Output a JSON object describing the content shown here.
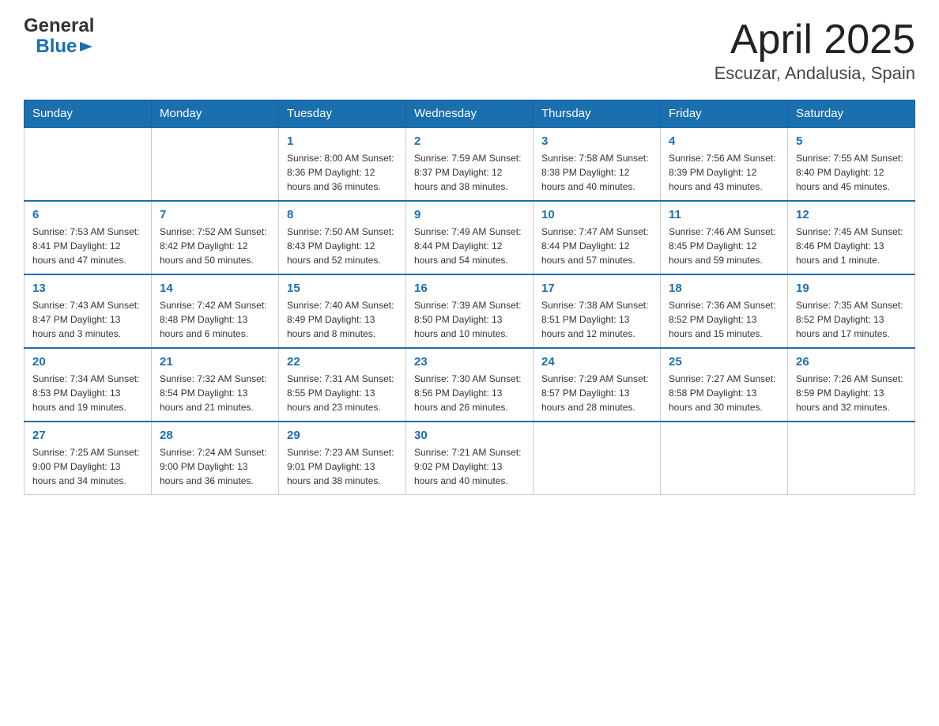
{
  "header": {
    "logo_text_general": "General",
    "logo_text_blue": "Blue",
    "title": "April 2025",
    "subtitle": "Escuzar, Andalusia, Spain"
  },
  "days_of_week": [
    "Sunday",
    "Monday",
    "Tuesday",
    "Wednesday",
    "Thursday",
    "Friday",
    "Saturday"
  ],
  "weeks": [
    [
      {
        "day": "",
        "info": ""
      },
      {
        "day": "",
        "info": ""
      },
      {
        "day": "1",
        "info": "Sunrise: 8:00 AM\nSunset: 8:36 PM\nDaylight: 12 hours\nand 36 minutes."
      },
      {
        "day": "2",
        "info": "Sunrise: 7:59 AM\nSunset: 8:37 PM\nDaylight: 12 hours\nand 38 minutes."
      },
      {
        "day": "3",
        "info": "Sunrise: 7:58 AM\nSunset: 8:38 PM\nDaylight: 12 hours\nand 40 minutes."
      },
      {
        "day": "4",
        "info": "Sunrise: 7:56 AM\nSunset: 8:39 PM\nDaylight: 12 hours\nand 43 minutes."
      },
      {
        "day": "5",
        "info": "Sunrise: 7:55 AM\nSunset: 8:40 PM\nDaylight: 12 hours\nand 45 minutes."
      }
    ],
    [
      {
        "day": "6",
        "info": "Sunrise: 7:53 AM\nSunset: 8:41 PM\nDaylight: 12 hours\nand 47 minutes."
      },
      {
        "day": "7",
        "info": "Sunrise: 7:52 AM\nSunset: 8:42 PM\nDaylight: 12 hours\nand 50 minutes."
      },
      {
        "day": "8",
        "info": "Sunrise: 7:50 AM\nSunset: 8:43 PM\nDaylight: 12 hours\nand 52 minutes."
      },
      {
        "day": "9",
        "info": "Sunrise: 7:49 AM\nSunset: 8:44 PM\nDaylight: 12 hours\nand 54 minutes."
      },
      {
        "day": "10",
        "info": "Sunrise: 7:47 AM\nSunset: 8:44 PM\nDaylight: 12 hours\nand 57 minutes."
      },
      {
        "day": "11",
        "info": "Sunrise: 7:46 AM\nSunset: 8:45 PM\nDaylight: 12 hours\nand 59 minutes."
      },
      {
        "day": "12",
        "info": "Sunrise: 7:45 AM\nSunset: 8:46 PM\nDaylight: 13 hours\nand 1 minute."
      }
    ],
    [
      {
        "day": "13",
        "info": "Sunrise: 7:43 AM\nSunset: 8:47 PM\nDaylight: 13 hours\nand 3 minutes."
      },
      {
        "day": "14",
        "info": "Sunrise: 7:42 AM\nSunset: 8:48 PM\nDaylight: 13 hours\nand 6 minutes."
      },
      {
        "day": "15",
        "info": "Sunrise: 7:40 AM\nSunset: 8:49 PM\nDaylight: 13 hours\nand 8 minutes."
      },
      {
        "day": "16",
        "info": "Sunrise: 7:39 AM\nSunset: 8:50 PM\nDaylight: 13 hours\nand 10 minutes."
      },
      {
        "day": "17",
        "info": "Sunrise: 7:38 AM\nSunset: 8:51 PM\nDaylight: 13 hours\nand 12 minutes."
      },
      {
        "day": "18",
        "info": "Sunrise: 7:36 AM\nSunset: 8:52 PM\nDaylight: 13 hours\nand 15 minutes."
      },
      {
        "day": "19",
        "info": "Sunrise: 7:35 AM\nSunset: 8:52 PM\nDaylight: 13 hours\nand 17 minutes."
      }
    ],
    [
      {
        "day": "20",
        "info": "Sunrise: 7:34 AM\nSunset: 8:53 PM\nDaylight: 13 hours\nand 19 minutes."
      },
      {
        "day": "21",
        "info": "Sunrise: 7:32 AM\nSunset: 8:54 PM\nDaylight: 13 hours\nand 21 minutes."
      },
      {
        "day": "22",
        "info": "Sunrise: 7:31 AM\nSunset: 8:55 PM\nDaylight: 13 hours\nand 23 minutes."
      },
      {
        "day": "23",
        "info": "Sunrise: 7:30 AM\nSunset: 8:56 PM\nDaylight: 13 hours\nand 26 minutes."
      },
      {
        "day": "24",
        "info": "Sunrise: 7:29 AM\nSunset: 8:57 PM\nDaylight: 13 hours\nand 28 minutes."
      },
      {
        "day": "25",
        "info": "Sunrise: 7:27 AM\nSunset: 8:58 PM\nDaylight: 13 hours\nand 30 minutes."
      },
      {
        "day": "26",
        "info": "Sunrise: 7:26 AM\nSunset: 8:59 PM\nDaylight: 13 hours\nand 32 minutes."
      }
    ],
    [
      {
        "day": "27",
        "info": "Sunrise: 7:25 AM\nSunset: 9:00 PM\nDaylight: 13 hours\nand 34 minutes."
      },
      {
        "day": "28",
        "info": "Sunrise: 7:24 AM\nSunset: 9:00 PM\nDaylight: 13 hours\nand 36 minutes."
      },
      {
        "day": "29",
        "info": "Sunrise: 7:23 AM\nSunset: 9:01 PM\nDaylight: 13 hours\nand 38 minutes."
      },
      {
        "day": "30",
        "info": "Sunrise: 7:21 AM\nSunset: 9:02 PM\nDaylight: 13 hours\nand 40 minutes."
      },
      {
        "day": "",
        "info": ""
      },
      {
        "day": "",
        "info": ""
      },
      {
        "day": "",
        "info": ""
      }
    ]
  ]
}
